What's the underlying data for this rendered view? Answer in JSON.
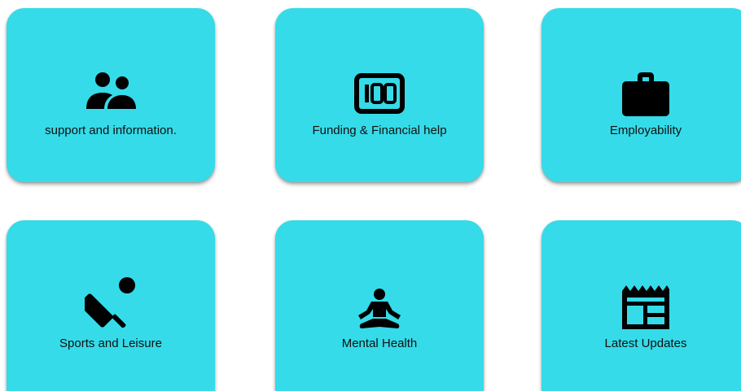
{
  "cards": [
    {
      "label": "support and information.",
      "icon": "people-icon"
    },
    {
      "label": "Funding & Financial help",
      "icon": "hundred-icon"
    },
    {
      "label": "Employability",
      "icon": "briefcase-icon"
    },
    {
      "label": "Sports and Leisure",
      "icon": "cricket-icon"
    },
    {
      "label": "Mental Health",
      "icon": "meditation-icon"
    },
    {
      "label": "Latest Updates",
      "icon": "newspaper-icon"
    }
  ],
  "colors": {
    "card_background": "#35DBE8",
    "icon": "#000000",
    "text": "#111111"
  }
}
